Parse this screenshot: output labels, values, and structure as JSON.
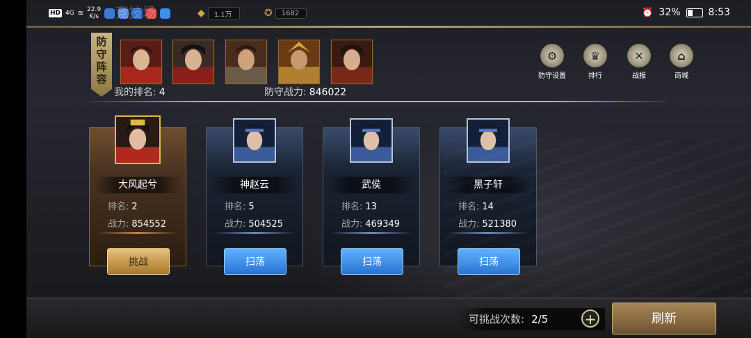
{
  "statusbar": {
    "hd": "HD",
    "signal": "4G",
    "net_speed": "22.9",
    "net_unit": "K/s",
    "battery": "32%",
    "time": "8:53",
    "ghost_title": "竞技场"
  },
  "resources": {
    "gold": "1.1万",
    "coins": "1682"
  },
  "defense": {
    "banner": [
      "防",
      "守",
      "阵",
      "容"
    ],
    "rank_label": "我的排名:",
    "rank_value": "4",
    "power_label": "防守战力:",
    "power_value": "846022"
  },
  "top_buttons": [
    {
      "label": "防守设置",
      "icon": "gear-icon"
    },
    {
      "label": "排行",
      "icon": "trophy-icon"
    },
    {
      "label": "战报",
      "icon": "crossed-swords-icon"
    },
    {
      "label": "商城",
      "icon": "shop-icon"
    }
  ],
  "opponents": [
    {
      "name": "大风起兮",
      "rank_label": "排名:",
      "rank": "2",
      "power_label": "战力:",
      "power": "854552",
      "button": "挑战",
      "style": "gold"
    },
    {
      "name": "神赵云",
      "rank_label": "排名:",
      "rank": "5",
      "power_label": "战力:",
      "power": "504525",
      "button": "扫荡",
      "style": "blue"
    },
    {
      "name": "武侯",
      "rank_label": "排名:",
      "rank": "13",
      "power_label": "战力:",
      "power": "469349",
      "button": "扫荡",
      "style": "blue"
    },
    {
      "name": "黑子轩",
      "rank_label": "排名:",
      "rank": "14",
      "power_label": "战力:",
      "power": "521380",
      "button": "扫荡",
      "style": "blue"
    }
  ],
  "bottom": {
    "attempts_label": "可挑战次数:",
    "attempts_value": "2/5",
    "plus": "+",
    "refresh": "刷新"
  }
}
